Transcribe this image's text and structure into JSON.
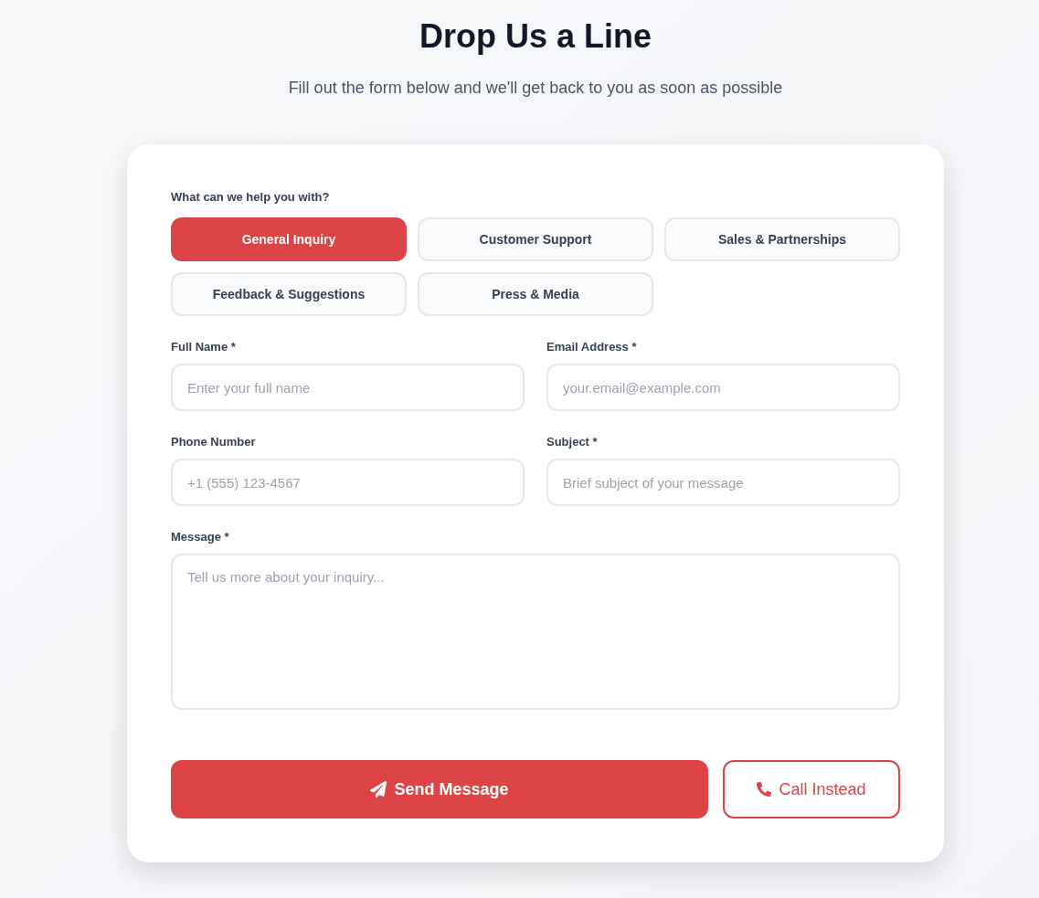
{
  "header": {
    "title": "Drop Us a Line",
    "subtitle": "Fill out the form below and we'll get back to you as soon as possible"
  },
  "form": {
    "topic_label": "What can we help you with?",
    "topics": [
      {
        "label": "General Inquiry",
        "selected": true
      },
      {
        "label": "Customer Support",
        "selected": false
      },
      {
        "label": "Sales & Partnerships",
        "selected": false
      },
      {
        "label": "Feedback & Suggestions",
        "selected": false
      },
      {
        "label": "Press & Media",
        "selected": false
      }
    ],
    "fields": [
      {
        "kind": "input",
        "label": "Full Name *",
        "placeholder": "Enter your full name"
      },
      {
        "kind": "input",
        "label": "Email Address *",
        "placeholder": "your.email@example.com"
      },
      {
        "kind": "input",
        "label": "Phone Number",
        "placeholder": "+1 (555) 123-4567"
      },
      {
        "kind": "input",
        "label": "Subject *",
        "placeholder": "Brief subject of your message"
      },
      {
        "kind": "textarea",
        "label": "Message *",
        "placeholder": "Tell us more about your inquiry..."
      }
    ],
    "actions": [
      {
        "kind": "primary",
        "label": "Send Message"
      },
      {
        "kind": "secondary",
        "label": "Call Instead"
      }
    ]
  }
}
